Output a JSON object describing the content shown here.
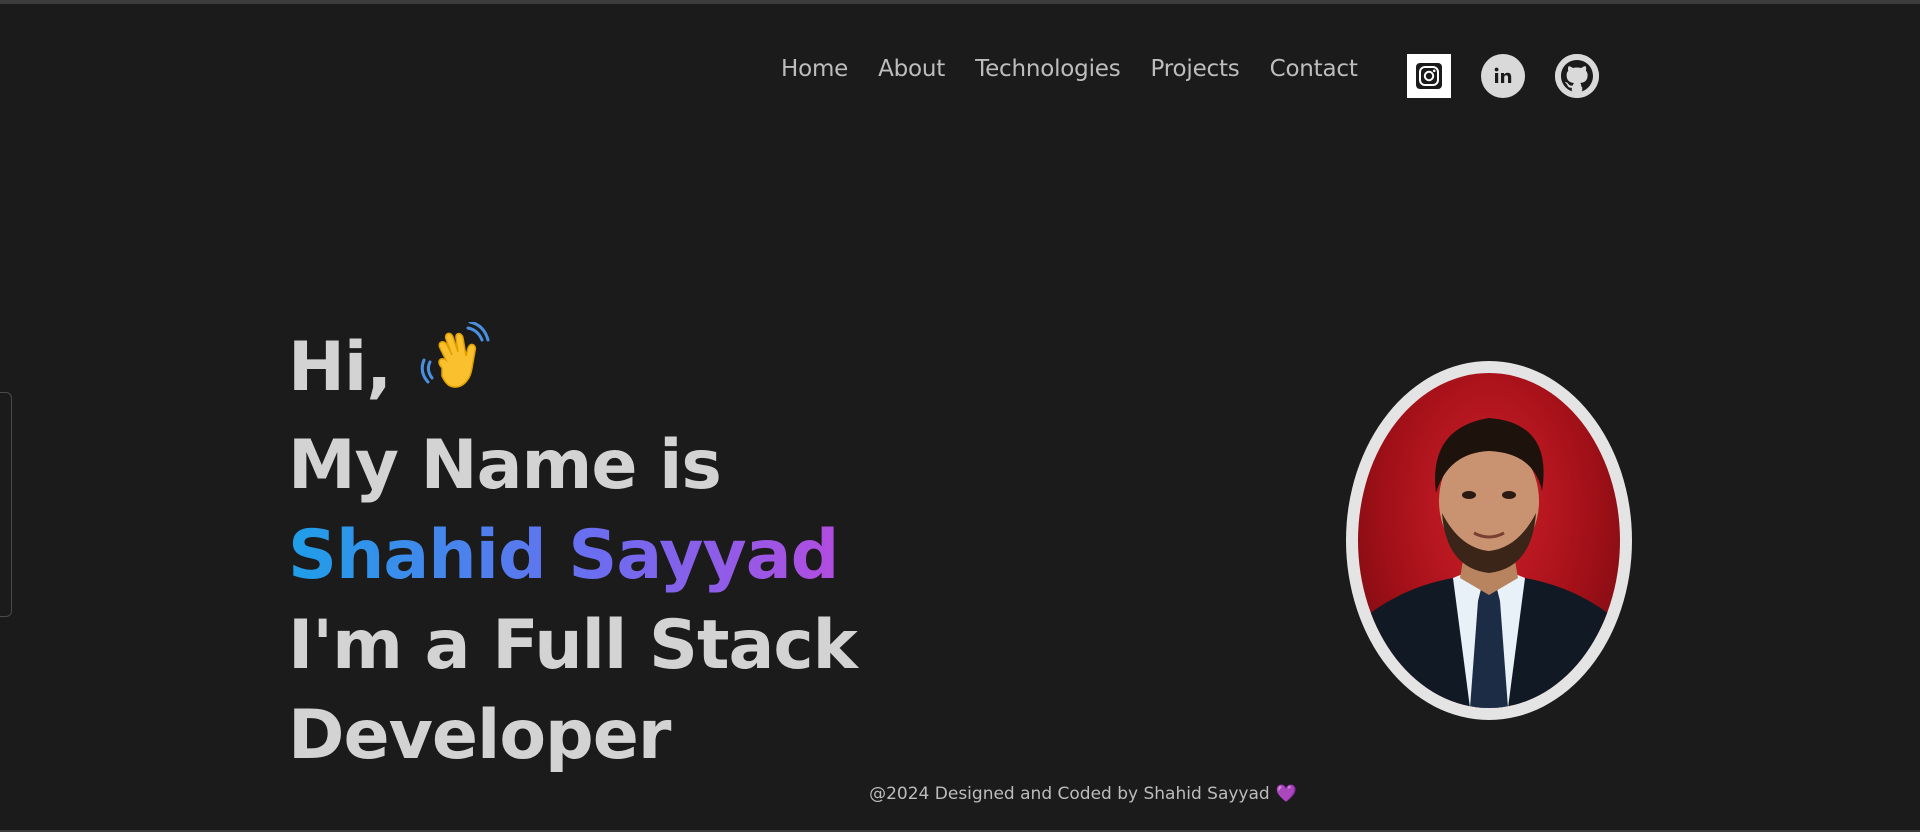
{
  "nav": {
    "items": [
      "Home",
      "About",
      "Technologies",
      "Projects",
      "Contact"
    ]
  },
  "socials": [
    {
      "name": "instagram",
      "icon": "instagram-icon"
    },
    {
      "name": "linkedin",
      "icon": "linkedin-icon"
    },
    {
      "name": "github",
      "icon": "github-icon"
    }
  ],
  "hero": {
    "greeting": "Hi,",
    "line2": "My Name is",
    "name": "Shahid Sayyad",
    "line4": "I'm a Full Stack",
    "line5": "Developer"
  },
  "footer": {
    "text": "@2024 Designed and Coded by Shahid Sayyad",
    "heart": "💜"
  },
  "colors": {
    "background": "#1b1b1b",
    "text": "#d3d3d3",
    "gradient_start": "#1e9fe8",
    "gradient_end": "#b24ce0"
  }
}
